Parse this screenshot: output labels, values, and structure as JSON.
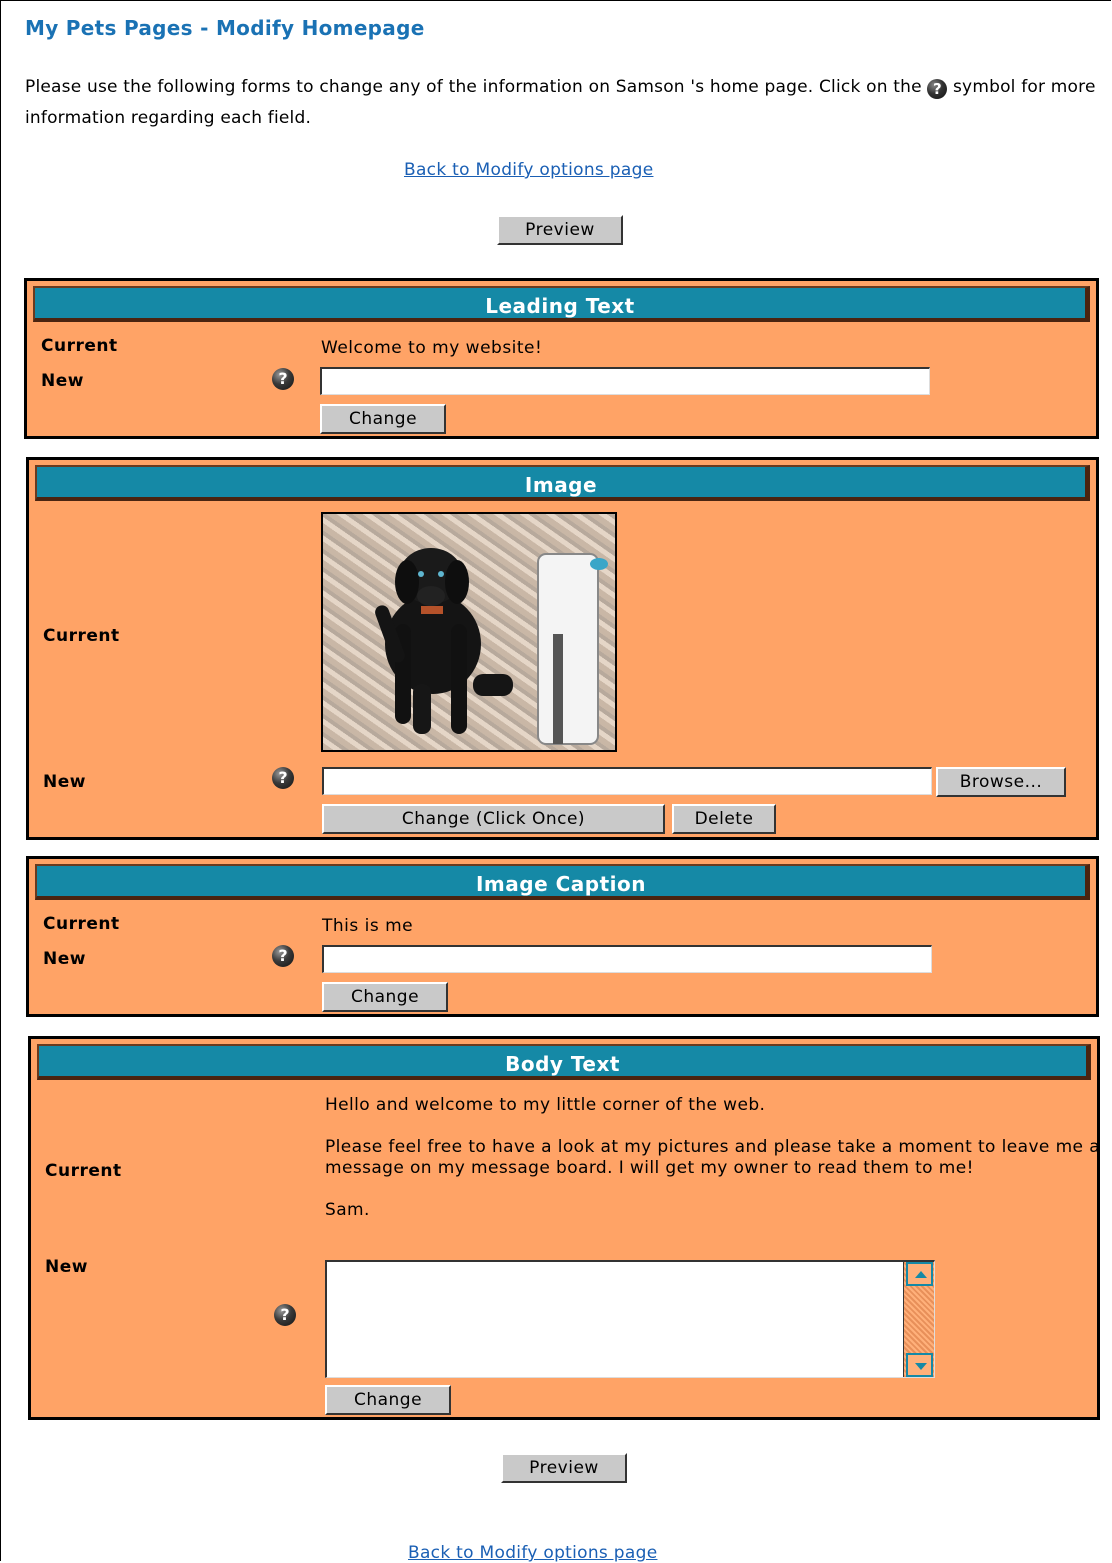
{
  "page": {
    "title": "My Pets Pages - Modify Homepage",
    "intro_part1": "Please use the following forms to change any of the information on Samson 's home page. Click on the",
    "intro_part2": "symbol for more information regarding each field.",
    "back_link": "Back to Modify options page",
    "preview_label": "Preview"
  },
  "labels": {
    "current": "Current",
    "new": "New",
    "help_glyph": "?"
  },
  "leading_text": {
    "heading": "Leading Text",
    "current_value": "Welcome to my website!",
    "new_value": "",
    "change_label": "Change"
  },
  "image": {
    "heading": "Image",
    "file_value": "",
    "browse_label": "Browse...",
    "change_label": "Change (Click Once)",
    "delete_label": "Delete"
  },
  "image_caption": {
    "heading": "Image Caption",
    "current_value": "This is me",
    "new_value": "",
    "change_label": "Change"
  },
  "body_text": {
    "heading": "Body Text",
    "current_paragraphs": [
      "Hello and welcome to my little corner of the web.",
      "Please feel free to have a look at my pictures and please take a moment to leave me a message on my message board. I will get my owner to read them to me!",
      "Sam."
    ],
    "new_value": "",
    "change_label": "Change"
  },
  "colors": {
    "panel_bg": "#ffa366",
    "header_bg": "#1589a6",
    "title_color": "#1a72b4",
    "link_color": "#1a5fb4"
  }
}
